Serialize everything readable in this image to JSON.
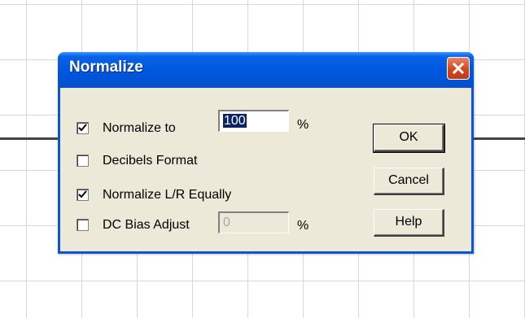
{
  "dialog": {
    "title": "Normalize",
    "options": [
      {
        "label": "Normalize to",
        "checked": true
      },
      {
        "label": "Decibels Format",
        "checked": false
      },
      {
        "label": "Normalize L/R Equally",
        "checked": true
      },
      {
        "label": "DC Bias Adjust",
        "checked": false
      }
    ],
    "normalize_value": "100",
    "dc_bias_value": "0",
    "percent_symbol": "%",
    "buttons": {
      "ok": "OK",
      "cancel": "Cancel",
      "help": "Help"
    }
  },
  "icons": {
    "close": "close-icon",
    "check": "check-icon"
  }
}
